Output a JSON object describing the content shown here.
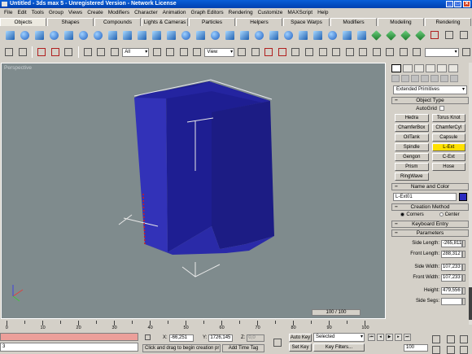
{
  "title": "Untitled - 3ds max 5 - Unregistered Version - Network License",
  "window_controls": {
    "min": "_",
    "max": "□",
    "close": "✕"
  },
  "menu": [
    "File",
    "Edit",
    "Tools",
    "Group",
    "Views",
    "Create",
    "Modifiers",
    "Character",
    "Animation",
    "Graph Editors",
    "Rendering",
    "Customize",
    "MAXScript",
    "Help"
  ],
  "tabs": [
    "Objects",
    "Shapes",
    "Compounds",
    "Lights & Cameras",
    "Particles",
    "Helpers",
    "Space Warps",
    "Modifiers",
    "Modeling",
    "Rendering"
  ],
  "active_tab": "Objects",
  "toolbar2": {
    "selection_filter": "All",
    "ref_coord": "View"
  },
  "viewport": {
    "label": "Perspective",
    "counter": "100 / 100"
  },
  "panel": {
    "category": "Extended Primitives",
    "object_type_title": "Object Type",
    "autogrid": "AutoGrid",
    "buttons": [
      "Hedra",
      "Torus Knot",
      "ChamferBox",
      "ChamferCyl",
      "OilTank",
      "Capsule",
      "Spindle",
      "L-Ext",
      "Gengon",
      "C-Ext",
      "Prism",
      "Hose",
      "RingWave"
    ],
    "selected_button": "L-Ext",
    "name_color_title": "Name and Color",
    "object_name": "L-Ext01",
    "object_color": "#2a2ac0",
    "creation_method_title": "Creation Method",
    "creation_options": [
      "Corners",
      "Center"
    ],
    "keyboard_entry_title": "Keyboard Entry",
    "parameters_title": "Parameters",
    "params": [
      {
        "label": "Side Length:",
        "value": "-265,811"
      },
      {
        "label": "Front Length:",
        "value": "288,312"
      },
      {
        "label": "Side Width:",
        "value": "107,233"
      },
      {
        "label": "Front Width:",
        "value": "107,233"
      },
      {
        "label": "Height:",
        "value": "479,556"
      },
      {
        "label": "Side Segs:",
        "value": ""
      }
    ]
  },
  "timeline": {
    "labels": [
      "0",
      "10",
      "20",
      "30",
      "40",
      "50",
      "60",
      "70",
      "80",
      "90",
      "100"
    ]
  },
  "status": {
    "command_line": "3",
    "prompt": "Click and drag to begin creation pr",
    "add_time_tag": "Add Time Tag",
    "x_label": "X:",
    "x_value": "-66,251",
    "y_label": "Y:",
    "y_value": "1726,145",
    "z_label": "Z:",
    "z_value": "0,0",
    "auto_key": "Auto Key",
    "set_key": "Set Key",
    "key_mode": "Selected",
    "key_filters": "Key Filters...",
    "frame": "100"
  }
}
